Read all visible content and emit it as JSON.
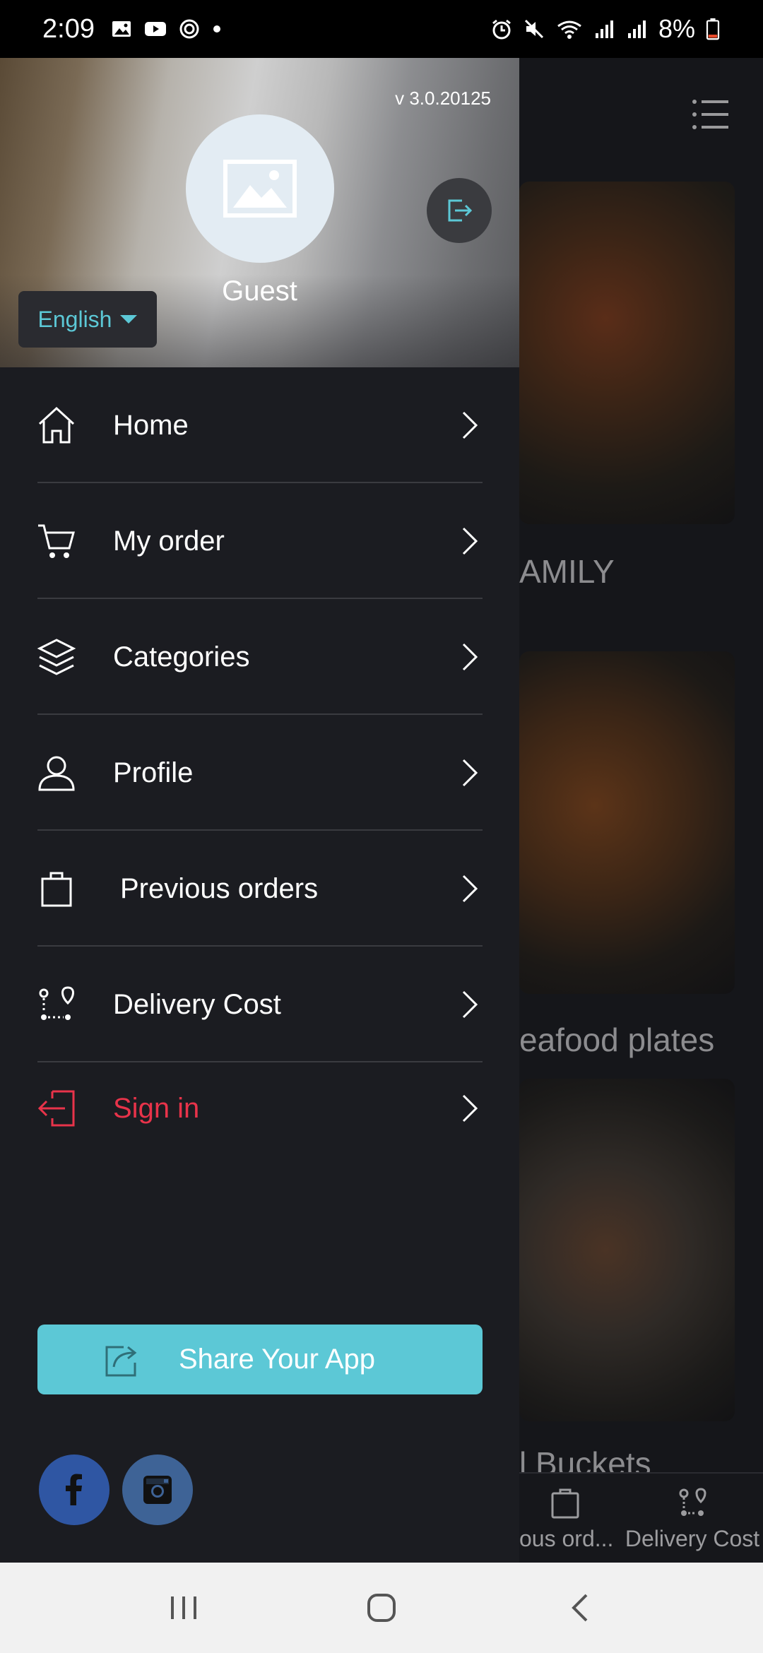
{
  "status_bar": {
    "time": "2:09",
    "battery": "8%",
    "left_icons": [
      "image-icon",
      "youtube-icon",
      "sync-icon",
      "dot-icon"
    ],
    "right_icons": [
      "alarm-icon",
      "mute-icon",
      "wifi-icon",
      "signal-icon",
      "signal-icon",
      "battery-icon"
    ]
  },
  "drawer": {
    "version": "v 3.0.20125",
    "user_name": "Guest",
    "language": "English",
    "items": [
      {
        "label": "Home",
        "icon": "home-icon"
      },
      {
        "label": "My order",
        "icon": "cart-icon"
      },
      {
        "label": "Categories",
        "icon": "layers-icon"
      },
      {
        "label": "Profile",
        "icon": "user-icon"
      },
      {
        "label": "Previous orders",
        "icon": "bag-icon"
      },
      {
        "label": "Delivery Cost",
        "icon": "route-icon"
      },
      {
        "label": "Sign in",
        "icon": "sign-in-icon",
        "color": "#e8334a"
      }
    ],
    "share_label": "Share Your App",
    "social": [
      "facebook-icon",
      "instagram-icon"
    ]
  },
  "background": {
    "labels": [
      "AMILY",
      "eafood plates",
      "l Buckets"
    ],
    "tabs": [
      "ous ord...",
      "Delivery Cost"
    ]
  },
  "colors": {
    "accent": "#5cc8d6",
    "drawer_bg": "#1b1c21",
    "sign_in": "#e8334a",
    "facebook": "#2f56a3"
  }
}
